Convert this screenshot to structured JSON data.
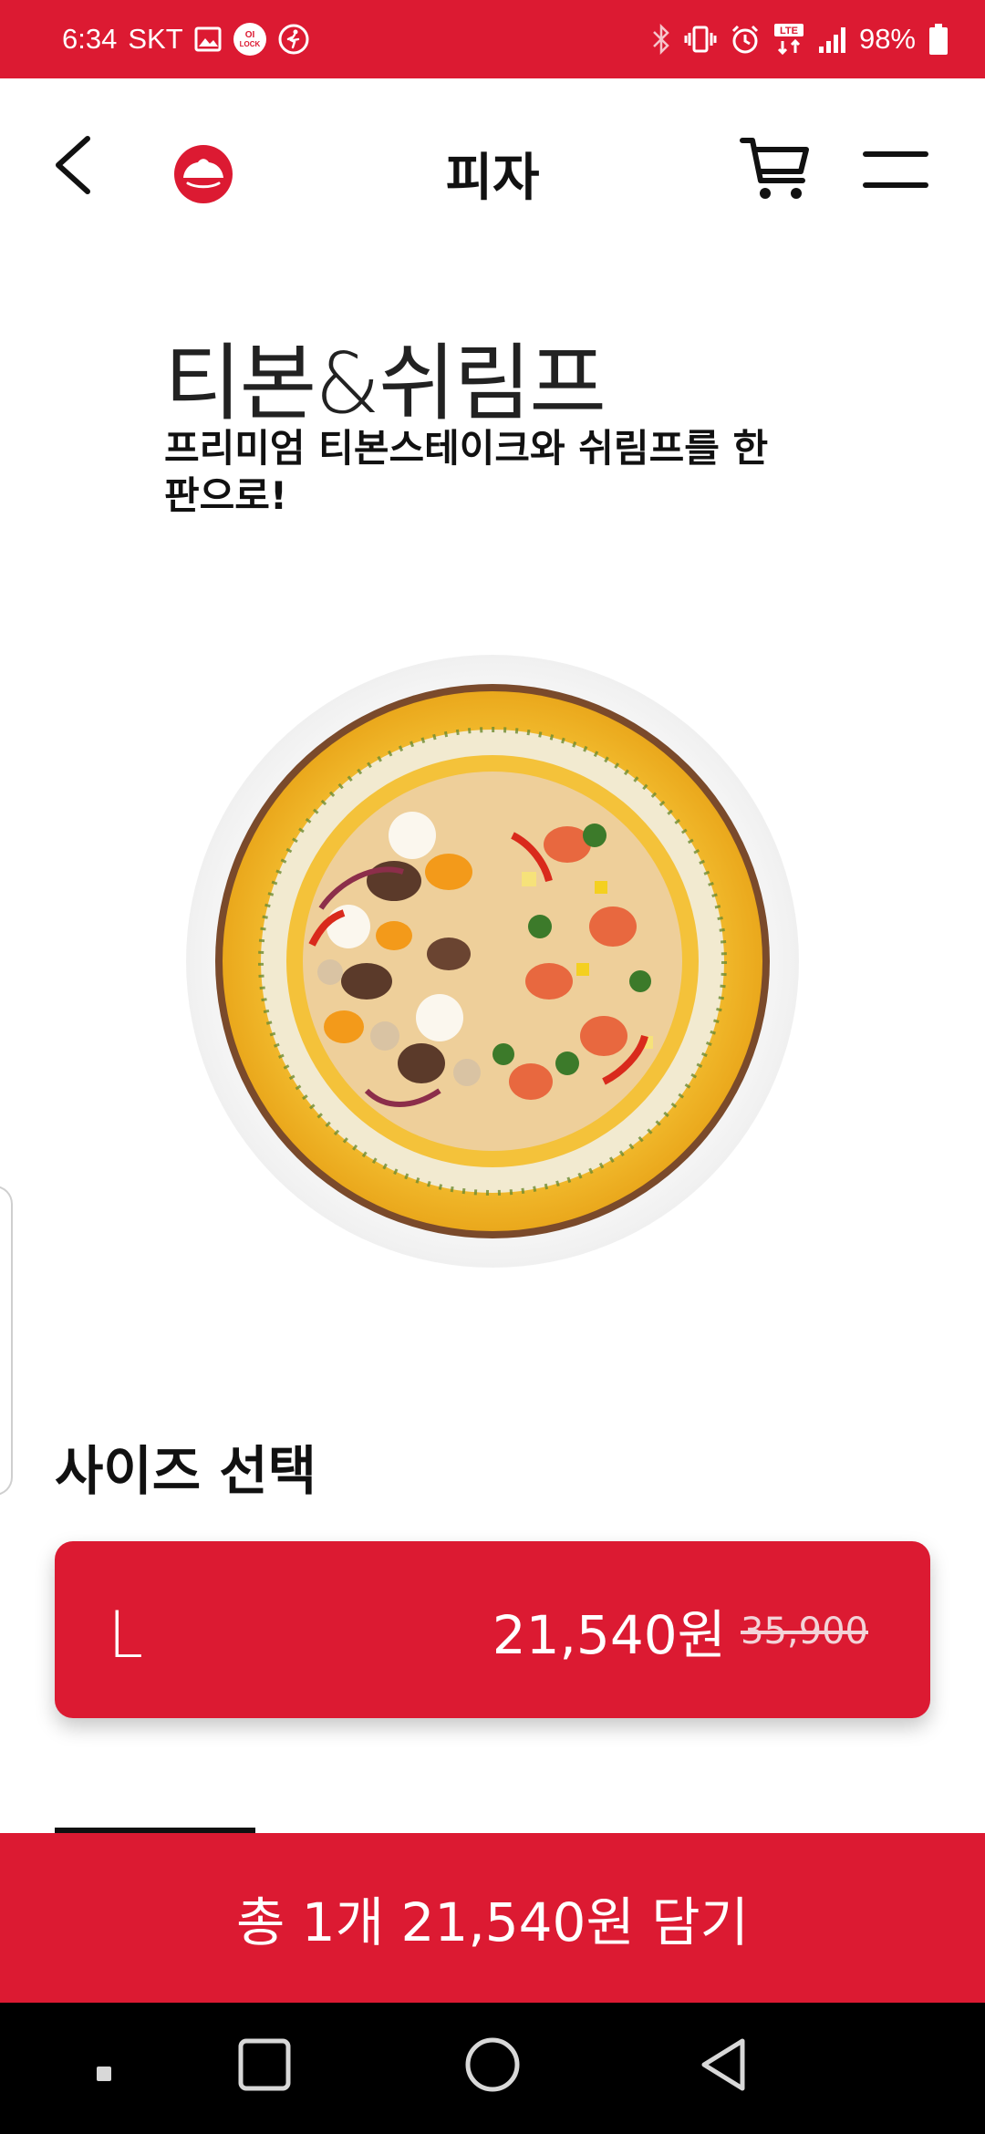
{
  "status_bar": {
    "time": "6:34",
    "carrier": "SKT",
    "lock_badge_text": "OI LOCK",
    "network": "LTE",
    "battery": "98%"
  },
  "header": {
    "title": "피자",
    "icons": {
      "back": "back-arrow-icon",
      "logo": "pizza-hut-logo",
      "cart": "cart-icon",
      "menu": "hamburger-menu-icon"
    }
  },
  "product": {
    "name": "티본&쉬림프",
    "description": "프리미엄 티본스테이크와 쉬림프를 한판으로!"
  },
  "size_section": {
    "title": "사이즈 선택",
    "options": [
      {
        "label": "L",
        "price": "21,540원",
        "original_price": "35,900"
      }
    ]
  },
  "add_to_cart": {
    "label": "총 1개 21,540원 담기"
  },
  "colors": {
    "brand_red": "#dc1a32",
    "text": "#111111",
    "nav_background": "#000000"
  }
}
